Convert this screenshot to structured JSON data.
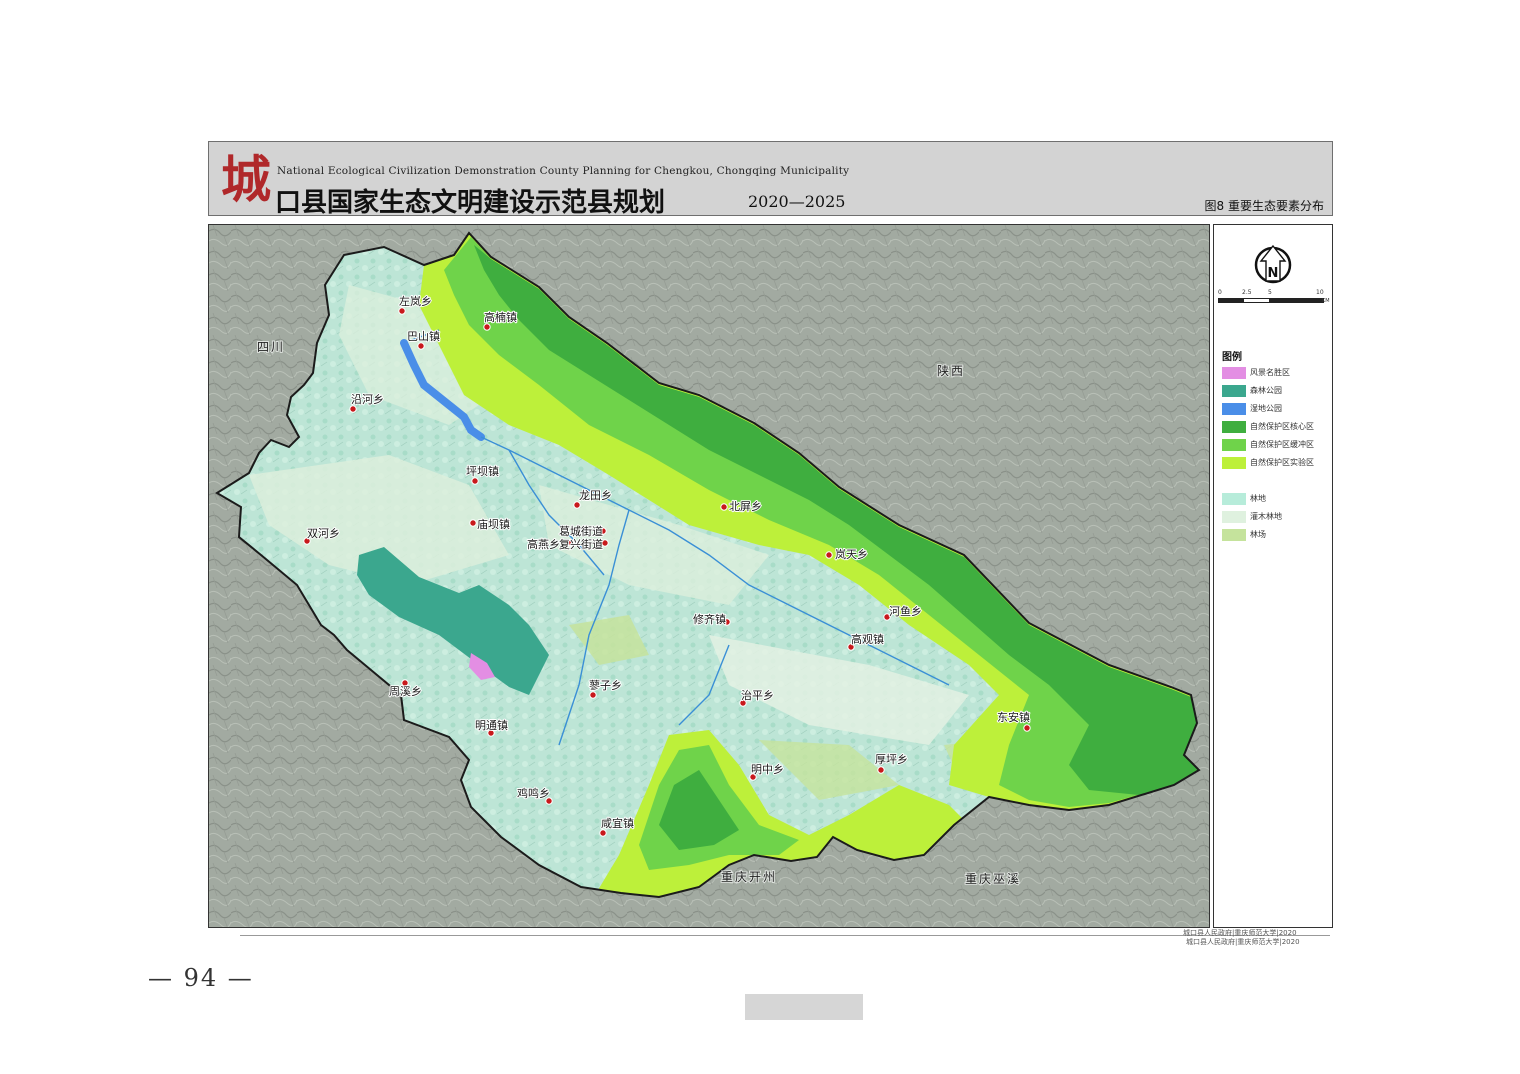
{
  "header": {
    "logo_char": "城",
    "title_en": "National Ecological Civilization Demonstration County Planning for Chengkou, Chongqing Municipality",
    "title_cn": "口县国家生态文明建设示范县规划",
    "years": "2020—2025",
    "figure_label": "图8 重要生态要素分布"
  },
  "regions": {
    "sichuan": "四川",
    "shaanxi": "陕西",
    "kaizhou": "重庆开州",
    "wuxi": "重庆巫溪"
  },
  "towns": [
    "左岚乡",
    "高楠镇",
    "巴山镇",
    "沿河乡",
    "坪坝镇",
    "龙田乡",
    "北屏乡",
    "双河乡",
    "庙坝镇",
    "高燕乡",
    "葛城街道",
    "复兴街道",
    "岚天乡",
    "河鱼乡",
    "修齐镇",
    "高观镇",
    "蓼子乡",
    "治平乡",
    "周溪乡",
    "明通镇",
    "东安镇",
    "厚坪乡",
    "明中乡",
    "鸡鸣乡",
    "咸宜镇"
  ],
  "scale_bar": {
    "ticks": [
      "0",
      "2.5",
      "5",
      "10"
    ],
    "unit": "KM"
  },
  "compass": {
    "label": "N"
  },
  "legend": {
    "title": "图例",
    "items": [
      {
        "label": "风景名胜区",
        "color": "#e38ee3"
      },
      {
        "label": "森林公园",
        "color": "#3ba78e"
      },
      {
        "label": "湿地公园",
        "color": "#4a8ee8"
      },
      {
        "label": "自然保护区核心区",
        "color": "#3fae3f"
      },
      {
        "label": "自然保护区缓冲区",
        "color": "#6fd34a"
      },
      {
        "label": "自然保护区实验区",
        "color": "#bdf03a"
      },
      {
        "label": "林地",
        "color": "#b7ecda"
      },
      {
        "label": "灌木林地",
        "color": "#dff1df"
      },
      {
        "label": "林场",
        "color": "#c5e39c"
      }
    ]
  },
  "credits": [
    "城口县人民政府|重庆师范大学|2020",
    "城口县人民政府|重庆师范大学|2020"
  ],
  "page_number": "— 94 —"
}
